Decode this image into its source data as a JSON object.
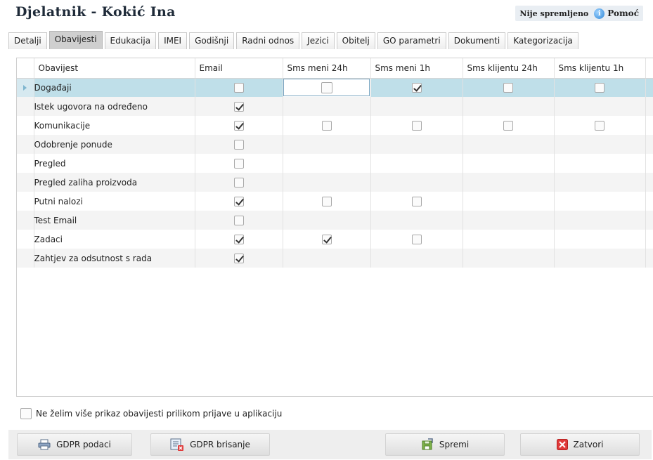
{
  "header": {
    "title": "Djelatnik - Kokić Ina",
    "status": "Nije spremljeno",
    "help_label": "Pomoć"
  },
  "tabs": [
    {
      "label": "Detalji"
    },
    {
      "label": "Obavijesti",
      "active": true
    },
    {
      "label": "Edukacija"
    },
    {
      "label": "IMEI"
    },
    {
      "label": "Godišnji"
    },
    {
      "label": "Radni odnos"
    },
    {
      "label": "Jezici"
    },
    {
      "label": "Obitelj"
    },
    {
      "label": "GO parametri"
    },
    {
      "label": "Dokumenti"
    },
    {
      "label": "Kategorizacija"
    }
  ],
  "grid": {
    "columns": [
      "Obavijest",
      "Email",
      "Sms meni 24h",
      "Sms meni 1h",
      "Sms klijentu 24h",
      "Sms klijentu 1h"
    ],
    "rows": [
      {
        "name": "Događaji",
        "email": false,
        "sms_me_24h": false,
        "sms_me_1h": true,
        "sms_client_24h": false,
        "sms_client_1h": false
      },
      {
        "name": "Istek ugovora na određeno",
        "email": true
      },
      {
        "name": "Komunikacije",
        "email": true,
        "sms_me_24h": false,
        "sms_me_1h": false,
        "sms_client_24h": false,
        "sms_client_1h": false
      },
      {
        "name": "Odobrenje ponude",
        "email": false
      },
      {
        "name": "Pregled",
        "email": false
      },
      {
        "name": "Pregled zaliha proizvoda",
        "email": false
      },
      {
        "name": "Putni nalozi",
        "email": true,
        "sms_me_24h": false,
        "sms_me_1h": false
      },
      {
        "name": "Test Email",
        "email": false
      },
      {
        "name": "Zadaci",
        "email": true,
        "sms_me_24h": true,
        "sms_me_1h": false
      },
      {
        "name": "Zahtjev za odsutnost s rada",
        "email": true
      }
    ]
  },
  "optout": {
    "label": "Ne želim više prikaz obavijesti prilikom prijave u aplikaciju",
    "checked": false
  },
  "footer": {
    "gdpr_data_label": "GDPR podaci",
    "gdpr_delete_label": "GDPR brisanje",
    "save_label": "Spremi",
    "close_label": "Zatvori"
  },
  "icons": {
    "help": "info-icon",
    "gdpr_data": "printer-icon",
    "gdpr_delete": "list-delete-icon",
    "save": "save-icon",
    "close": "close-icon"
  },
  "colors": {
    "selected_row": "#bfdfe9",
    "close_red": "#e03a3a",
    "help_blue": "#2f86d6"
  }
}
